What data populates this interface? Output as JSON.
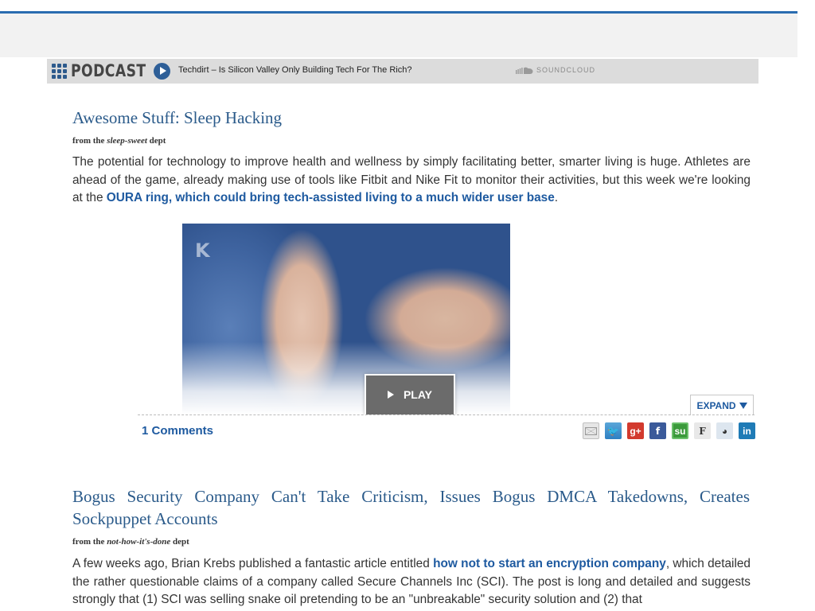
{
  "podcast": {
    "logo_text": "PODCAST",
    "episode_title": "Techdirt – Is Silicon Valley Only Building Tech For The Rich?",
    "provider": "SOUNDCLOUD"
  },
  "article1": {
    "title": "Awesome Stuff: Sleep Hacking",
    "dept_prefix": "from the",
    "dept_name": "sleep-sweet",
    "dept_suffix": "dept",
    "body_before_link": "The potential for technology to improve health and wellness by simply facilitating better, smarter living is huge. Athletes are ahead of the game, already making use of tools like Fitbit and Nike Fit to monitor their activities, but this week we're looking at the",
    "link_text": "OURA ring, which could bring tech-assisted living to a much wider user base",
    "body_after_link": ".",
    "image_watermark": "K",
    "play_label": "PLAY",
    "expand_label": "EXPAND",
    "comments_label": "1 Comments"
  },
  "share_icons": [
    "email-icon",
    "twitter-icon",
    "google-plus-icon",
    "facebook-icon",
    "stumbleupon-icon",
    "fark-icon",
    "reddit-icon",
    "linkedin-icon"
  ],
  "article2": {
    "title": "Bogus Security Company Can't Take Criticism, Issues Bogus DMCA Takedowns, Creates Sockpuppet Accounts",
    "dept_prefix": "from the",
    "dept_name": "not-how-it's-done",
    "dept_suffix": "dept",
    "body_before_link": "A few weeks ago, Brian Krebs published a fantastic article entitled",
    "link_text": "how not to start an encryption company",
    "body_after_link": ", which detailed the rather questionable claims of a company called Secure Channels Inc (SCI). The post is long and detailed and suggests strongly that (1) SCI was selling snake oil pretending to be an \"unbreakable\" security solution and (2) that"
  },
  "colors": {
    "accent": "#2a6cb0",
    "title": "#2a5a8a",
    "link": "#1e5aa0",
    "podcast_bar": "#dcdcdc"
  }
}
